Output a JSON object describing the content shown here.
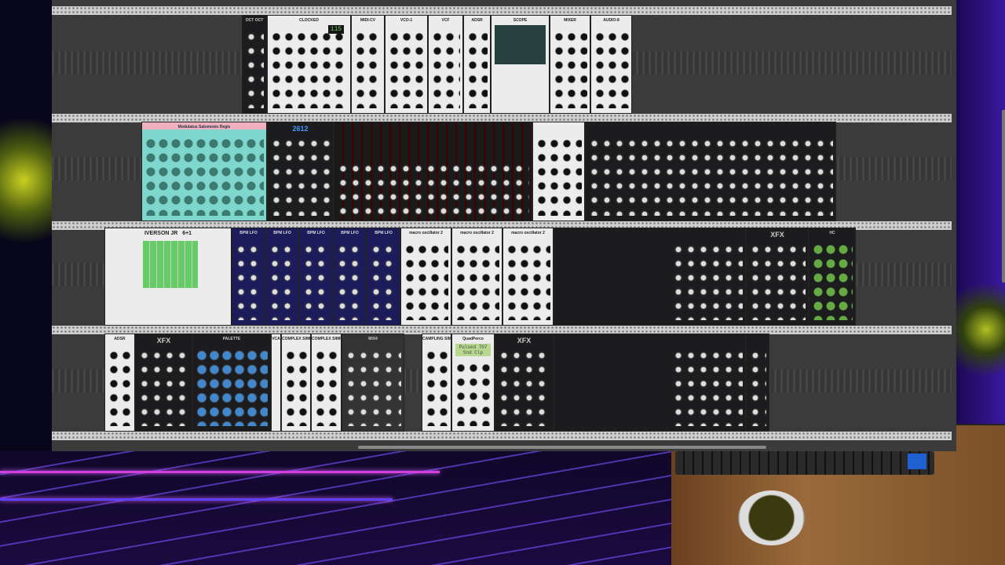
{
  "rack": {
    "row1": [
      {
        "title": "OCT OCT"
      },
      {
        "title": "CLOCKED",
        "bpm": "115"
      },
      {
        "title": "MIDI-CV"
      },
      {
        "title": "VCO-1"
      },
      {
        "title": "VCF"
      },
      {
        "title": "ADSR"
      },
      {
        "title": "SCOPE"
      },
      {
        "title": "MIXER"
      },
      {
        "title": "AUDIO-8"
      }
    ],
    "row2": [
      {
        "title": "Modulatus Salomonis Regis"
      },
      {
        "title": "2612"
      },
      {
        "title": ""
      },
      {
        "title": ""
      },
      {
        "title": ""
      }
    ],
    "row3": [
      {
        "title": "IVERSON JR"
      },
      {
        "title": "6+1"
      },
      {
        "title": "BPM LFO"
      },
      {
        "title": "BPM LFO"
      },
      {
        "title": "BPM LFO"
      },
      {
        "title": "BPM LFO"
      },
      {
        "title": "BPM LFO"
      },
      {
        "title": "macro oscillator 2"
      },
      {
        "title": "macro oscillator 2"
      },
      {
        "title": "macro oscillator 2"
      },
      {
        "title": ""
      },
      {
        "title": "XFX"
      },
      {
        "title": "HC"
      }
    ],
    "row4": [
      {
        "title": "ADSR"
      },
      {
        "title": "XFX"
      },
      {
        "title": "PALETTE"
      },
      {
        "title": "VCA"
      },
      {
        "title": "COMPLEX SIMPLER"
      },
      {
        "title": "COMPLEX SIMPLER"
      },
      {
        "title": "MIX4"
      },
      {
        "title": "CAMPLING SIMPLER"
      },
      {
        "title": "QuadPerco",
        "display": "Pulsed 707 Snd Clp"
      },
      {
        "title": "XFX"
      },
      {
        "title": ""
      },
      {
        "title": ""
      }
    ]
  },
  "colors": {
    "rail": "#cfcfcf",
    "rack": "#3b3b3b",
    "neon": "#d040e0"
  }
}
